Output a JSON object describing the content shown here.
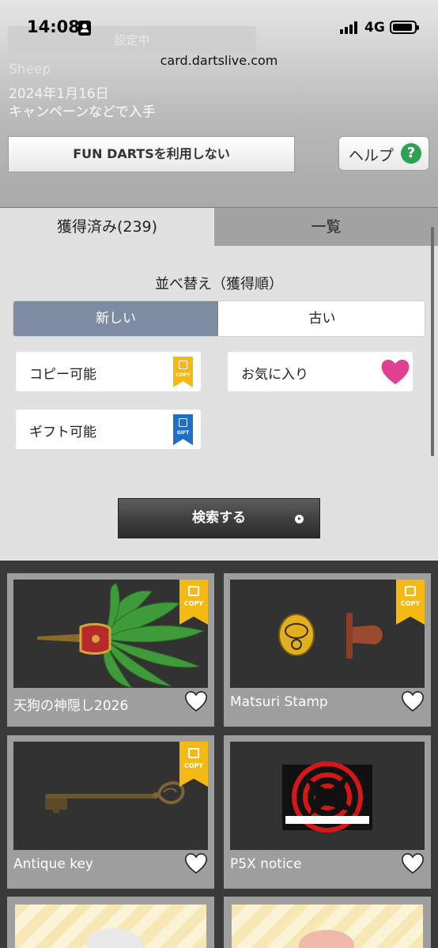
{
  "status_bar": {
    "time": "14:08",
    "network": "4G"
  },
  "browser": {
    "url": "card.dartslive.com"
  },
  "header": {
    "faded_button_label": "設定中",
    "faded_name": "Sheep",
    "date": "2024年1月16日",
    "source": "キャンペーンなどで入手",
    "fun_darts_button": "FUN DARTSを利用しない",
    "help_button": "ヘルプ",
    "help_icon_glyph": "?"
  },
  "tabs": [
    {
      "label": "獲得済み(239)",
      "active": true
    },
    {
      "label": "一覧",
      "active": false
    }
  ],
  "sort": {
    "title": "並べ替え（獲得順）",
    "options": [
      {
        "label": "新しい",
        "selected": true
      },
      {
        "label": "古い",
        "selected": false
      }
    ]
  },
  "filters": {
    "copy": {
      "label": "コピー可能",
      "badge": "COPY",
      "color": "#f5b914"
    },
    "favorite": {
      "label": "お気に入り",
      "color": "#e0408f"
    },
    "gift": {
      "label": "ギフト可能",
      "badge": "GIFT",
      "color": "#1e6fc8"
    }
  },
  "search_button": "検索する",
  "cards": [
    {
      "name": "天狗の神隠し2026",
      "badge": "COPY",
      "favorite": false
    },
    {
      "name": "Matsuri Stamp",
      "badge": "COPY",
      "favorite": false
    },
    {
      "name": "Antique key",
      "badge": "COPY",
      "favorite": false
    },
    {
      "name": "P5X notice",
      "badge": "",
      "favorite": false
    }
  ]
}
